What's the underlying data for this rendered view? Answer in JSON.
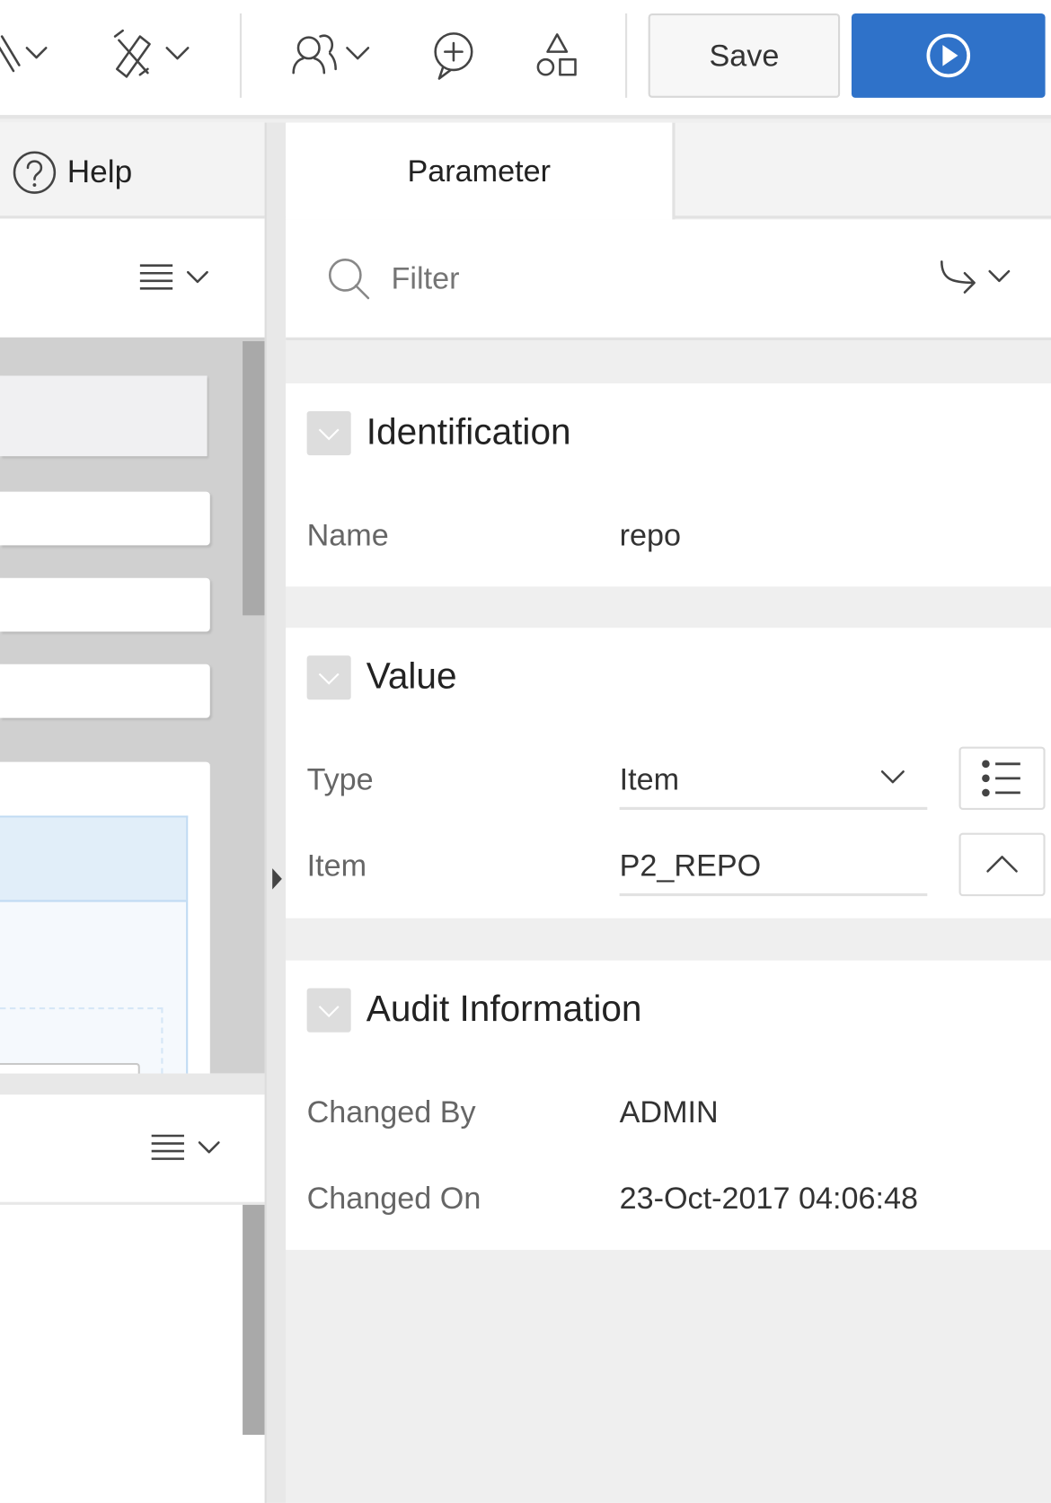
{
  "toolbar": {
    "save_label": "Save",
    "run_icon": "play-circle-icon",
    "icons": [
      "pencil-icon",
      "utilities-icon",
      "team-development-icon",
      "comment-add-icon",
      "shared-components-icon"
    ],
    "accent": "#2f72c9"
  },
  "left_panel": {
    "help_tab": "Help"
  },
  "right_panel": {
    "tabs": [
      "Parameter"
    ],
    "filter_placeholder": "Filter",
    "sections": {
      "identification": {
        "title": "Identification",
        "name_label": "Name",
        "name_value": "repo"
      },
      "value": {
        "title": "Value",
        "type_label": "Type",
        "type_value": "Item",
        "item_label": "Item",
        "item_value": "P2_REPO"
      },
      "audit": {
        "title": "Audit Information",
        "changed_by_label": "Changed By",
        "changed_by_value": "ADMIN",
        "changed_on_label": "Changed On",
        "changed_on_value": "23-Oct-2017 04:06:48"
      }
    }
  }
}
